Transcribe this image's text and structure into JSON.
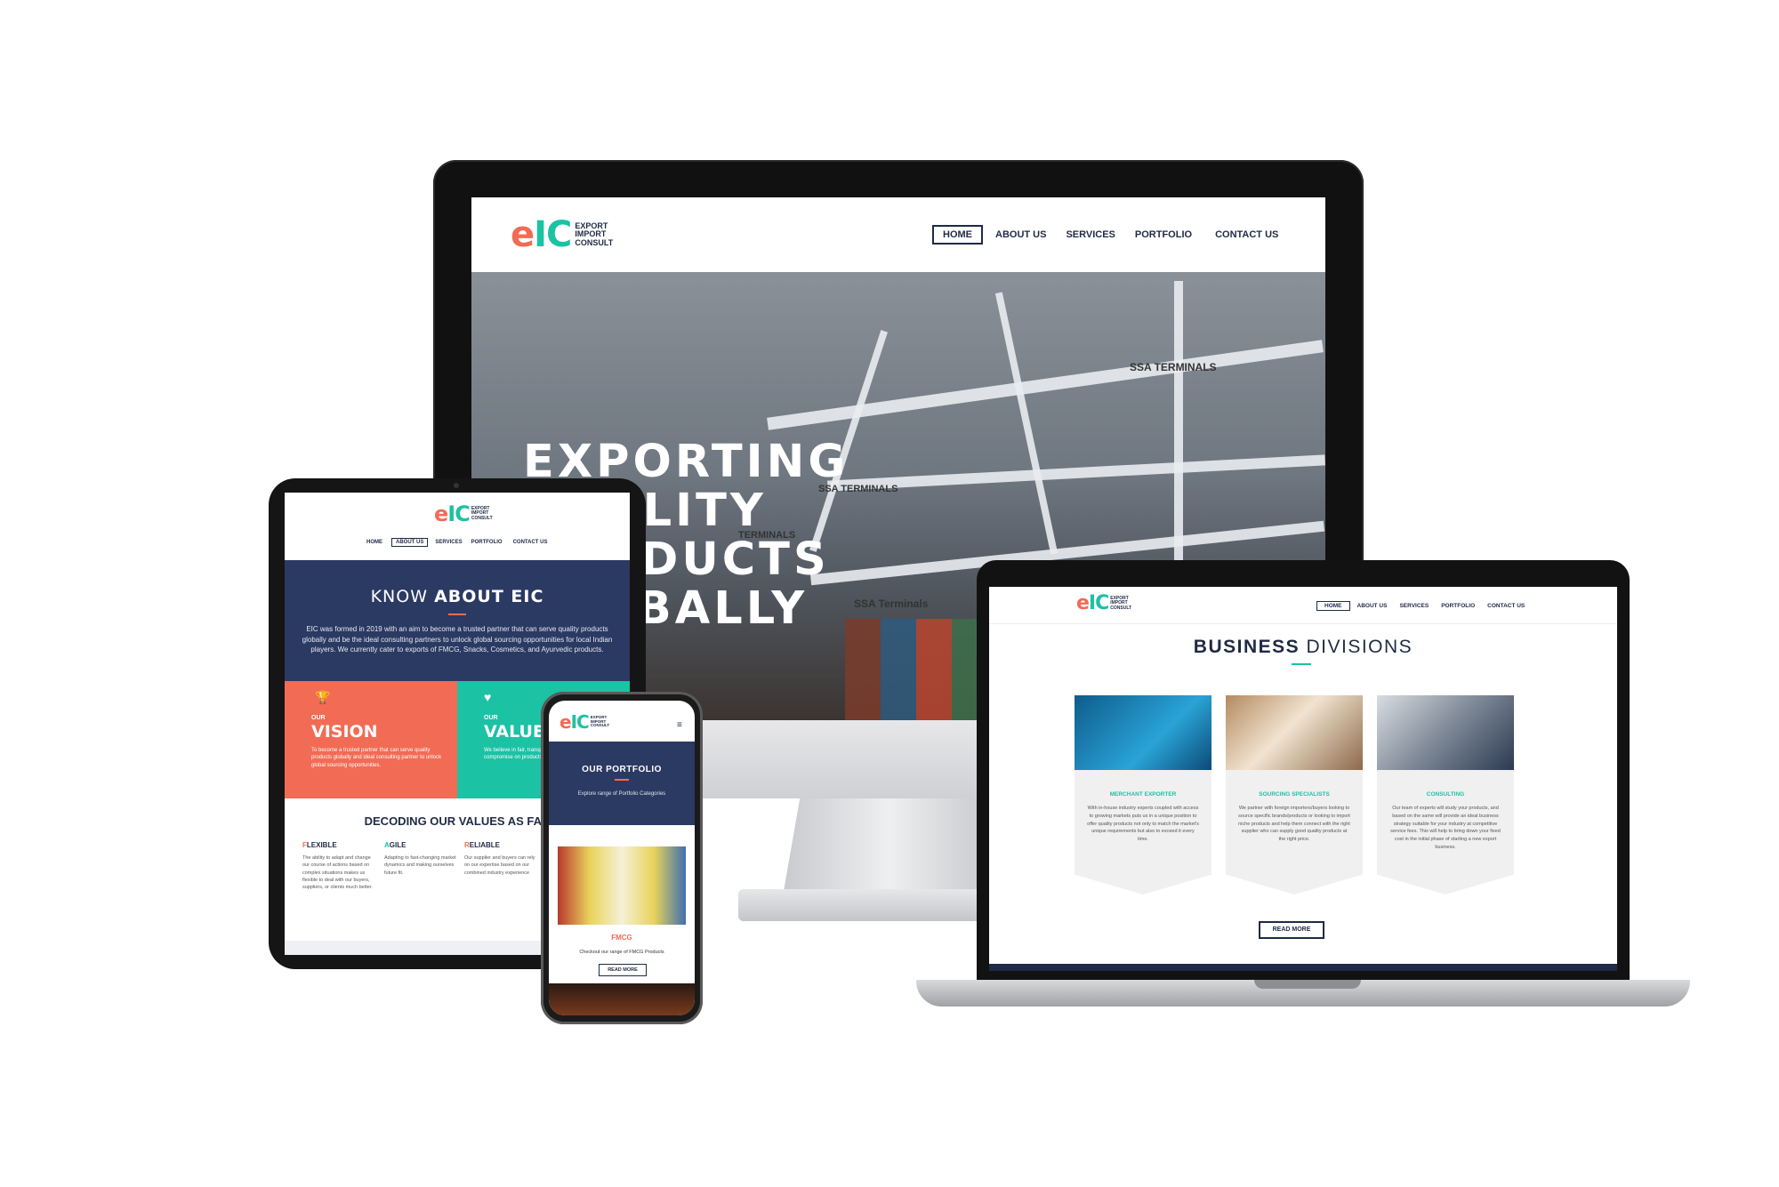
{
  "logo": {
    "e": "e",
    "ic": "IC",
    "line1": "EXPORT",
    "line2": "IMPORT",
    "line3": "CONSULT"
  },
  "nav": {
    "home": "HOME",
    "about": "ABOUT US",
    "services": "SERVICES",
    "portfolio": "PORTFOLIO",
    "contact": "CONTACT US"
  },
  "monitor": {
    "hero_lines": [
      "EXPORTING",
      "QUALITY",
      "PRODUCTS",
      "GLOBALLY"
    ],
    "crane_labels": [
      "SSA TERMINALS",
      "SSA TERMINALS",
      "TERMINALS",
      "SSA Terminals"
    ]
  },
  "tablet": {
    "about_title_light": "KNOW ",
    "about_title_bold": "ABOUT EIC",
    "about_text": "EIC was formed in 2019 with an aim to become a trusted partner that can serve quality products globally and be the ideal consulting partners to unlock global sourcing opportunities for local Indian players. We currently cater to exports of FMCG, Snacks, Cosmetics, and Ayurvedic products.",
    "vision_small": "OUR",
    "vision_title": "VISION",
    "vision_text": "To become a trusted partner that can serve quality products globally and ideal consulting partner to unlock global sourcing opportunities.",
    "values_small": "OUR",
    "values_title": "VALUES",
    "values_text": "We believe in fair, transparent business. We don't compromise on products and never believe in the deal.",
    "decoding_title": "DECODING OUR VALUES AS FAR",
    "values": [
      {
        "first": "F",
        "rest": "LEXIBLE",
        "text": "The ability to adapt and change our course of actions based on complex situations makes us flexible to deal with our buyers, suppliers, or clients much better."
      },
      {
        "first": "A",
        "rest": "GILE",
        "text": "Adapting to fast-changing market dynamics and making ourselves future fit."
      },
      {
        "first": "R",
        "rest": "ELIABLE",
        "text": "Our supplier and buyers can rely on our expertise based on our combined industry experience"
      }
    ]
  },
  "laptop": {
    "title_bold": "BUSINESS ",
    "title_light": "DIVISIONS",
    "divisions": [
      {
        "name": "MERCHANT EXPORTER",
        "text": "With in-house industry experts coupled with access to growing markets puts us in a unique position to offer quality products not only to match the market's unique requirements but also to exceed it every time."
      },
      {
        "name": "SOURCING SPECIALISTS",
        "text": "We partner with foreign importers/buyers looking to source specific brands/products or looking to import niche products and help them connect with the right supplier who can supply good quality products at the right price."
      },
      {
        "name": "CONSULTING",
        "text": "Our team of experts will study your products, and based on the same will provide an ideal business strategy suitable for your industry at competitive service fees. This will help to bring down your fixed cost in the initial phase of starting a new export business."
      }
    ],
    "read_more": "READ MORE"
  },
  "phone": {
    "portfolio_title": "OUR PORTFOLIO",
    "portfolio_sub": "Explore range of Portfolio Categories",
    "category": "FMCG",
    "category_text": "Checkout our range of FMCG Products",
    "read_more": "READ MORE"
  },
  "colors": {
    "navy": "#2b3a63",
    "coral": "#f26b55",
    "teal": "#1cc2a4",
    "dark": "#1f2a44"
  }
}
